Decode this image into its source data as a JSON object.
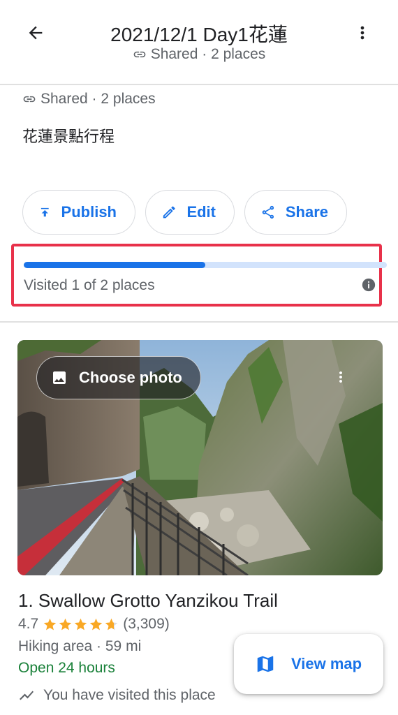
{
  "header": {
    "title": "2021/12/1 Day1花蓮",
    "subtitle": "Shared · 2 places",
    "back_icon": "arrow-back-icon",
    "more_icon": "more-vert-icon"
  },
  "list_info": {
    "meta": "Shared · 2 places",
    "description": "花蓮景點行程"
  },
  "actions": [
    {
      "label": "Publish",
      "icon": "publish-icon"
    },
    {
      "label": "Edit",
      "icon": "edit-icon"
    },
    {
      "label": "Share",
      "icon": "share-icon"
    }
  ],
  "progress": {
    "label": "Visited 1 of 2 places",
    "visited": 1,
    "total": 2,
    "fraction": 0.5
  },
  "place": {
    "choose_photo_label": "Choose photo",
    "title": "1. Swallow Grotto Yanzikou Trail",
    "rating": "4.7",
    "stars": 4.7,
    "reviews": "(3,309)",
    "type_distance": "Hiking area · 59 mi",
    "open_status": "Open 24 hours",
    "visited_note": "You have visited this place"
  },
  "view_map": {
    "label": "View map",
    "icon": "map-icon"
  },
  "colors": {
    "accent": "#1a73e8",
    "open_green": "#188038",
    "highlight_red": "#e8314a",
    "star": "#f9a825"
  }
}
